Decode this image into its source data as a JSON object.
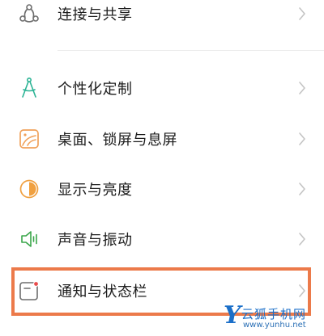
{
  "settings": {
    "items": [
      {
        "label": "连接与共享",
        "icon": "share-connect-icon"
      },
      {
        "label": "个性化定制",
        "icon": "compass-icon"
      },
      {
        "label": "桌面、锁屏与息屏",
        "icon": "wallpaper-icon"
      },
      {
        "label": "显示与亮度",
        "icon": "brightness-icon"
      },
      {
        "label": "声音与振动",
        "icon": "speaker-icon"
      },
      {
        "label": "通知与状态栏",
        "icon": "notification-icon"
      }
    ]
  },
  "colors": {
    "highlight": "#ec7a4a",
    "personalize_icon": "#2bb394",
    "wallpaper_icon": "#f0a15a",
    "brightness_icon": "#f0a040",
    "speaker_icon": "#3aa64a",
    "notification_dot": "#e94b4b",
    "watermark": "#1b6fc9"
  },
  "watermark": {
    "letter": "Y",
    "title": "云狐手机网",
    "url": "www.yunhu.net"
  }
}
